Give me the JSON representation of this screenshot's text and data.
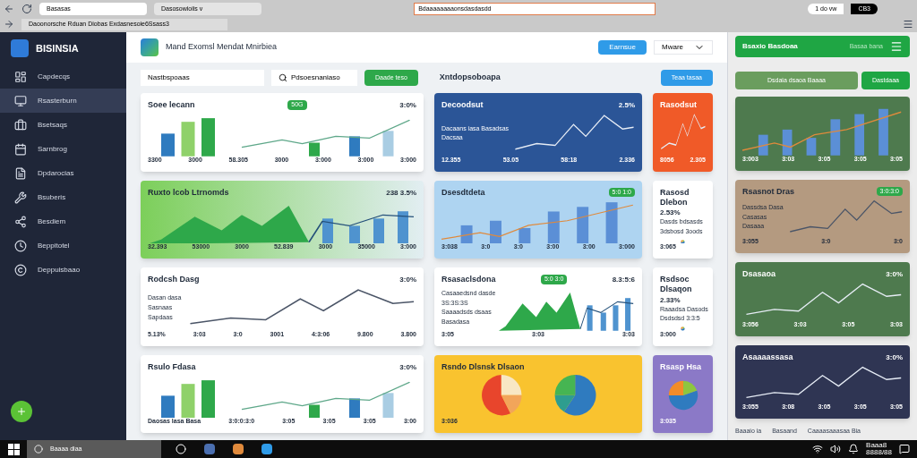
{
  "browser": {
    "tabs": [
      {
        "label": "Basasas",
        "selected": true
      },
      {
        "label": "Dasosowioiis v",
        "selected": false
      }
    ],
    "address": "Daoonorsche Rduan Diobas Exdasnesoie6Ssass3",
    "popup_address": "Bdaaaaaaaaonsdasdasdd",
    "pill": "1 do vw",
    "pill_dark": "CB3"
  },
  "sidebar": {
    "brand": "BISINSIA",
    "items": [
      {
        "label": "Capdecqs",
        "selected": false
      },
      {
        "label": "Rsasterburn",
        "selected": true
      },
      {
        "label": "Bsetsaqs",
        "selected": false
      },
      {
        "label": "Sarnbrog",
        "selected": false
      },
      {
        "label": "Dpdarocias",
        "selected": false
      },
      {
        "label": "Bsuberis",
        "selected": false
      },
      {
        "label": "Besdiem",
        "selected": false
      },
      {
        "label": "Beppitotel",
        "selected": false
      },
      {
        "label": "Deppuisbaao",
        "selected": false
      }
    ]
  },
  "header": {
    "title": "Mand Exomsl Mendat Mnirbiea",
    "button": "Earnsue",
    "select": "Mware"
  },
  "toolbar": {
    "input": "Nastbspoaas",
    "search": "Pdsoesnaniaso",
    "button": "Daade teso",
    "section_title": "Xntdopsoboapa",
    "section_button": "Teaa tasaa"
  },
  "cards": [
    {
      "color": "#ffffff",
      "kind": "bar-line",
      "title": "Soee lecann",
      "tag": "50G",
      "value": "3:0%",
      "stats": [
        "3300",
        "3000",
        "58.305",
        "3000",
        "3:000",
        "3:000",
        "3:000"
      ]
    },
    {
      "color": "#2b5597",
      "kind": "line",
      "title": "Decoodsut",
      "value": "2.5%",
      "legend": [
        "Dacaans iasa Basadsas",
        "Dacsaa"
      ],
      "stats": [
        "12.355",
        "53.05",
        "58:18",
        "2.336"
      ]
    },
    {
      "color": "#f05a28",
      "kind": "line",
      "title": "Rasodsut",
      "stats": [
        "8056",
        "2.305"
      ]
    },
    {
      "color": "#7ccf5a",
      "kind": "area",
      "title": "Ruxto lcob Ltrnomds",
      "value": "238 3.5%",
      "stats": [
        "32.393",
        "53000",
        "3000",
        "52.839",
        "3000",
        "35000",
        "3:000"
      ]
    },
    {
      "color": "#aed4f1",
      "kind": "bars",
      "title": "Dsesdtdeta",
      "tag": "5:0 1:0",
      "stats": [
        "3:038",
        "3:0",
        "3:0",
        "3:00",
        "3:00",
        "3:000"
      ]
    },
    {
      "color": "#ffffff",
      "kind": "pie",
      "title": "Rasosd Dlebon",
      "legend": [
        "Dasds bdsasds",
        "3dsbosd 3oods"
      ],
      "value": "2.53%",
      "stats": [
        "3:065"
      ]
    },
    {
      "color": "#ffffff",
      "kind": "line",
      "title": "Rodcsh Dasg",
      "value": "3:0%",
      "legend": [
        "Dasan dasa",
        "Sasnaas",
        "Sapdaas"
      ],
      "stats": [
        "5.13%",
        "3:03",
        "3:0",
        "3001",
        "4:3:06",
        "9.800",
        "3.800"
      ]
    },
    {
      "color": "#ffffff",
      "kind": "area",
      "title": "Rsasaclsdona",
      "tag": "5:0 3:0",
      "legend": [
        "Casaaedsnd dasde",
        "3S:3S:3S",
        "Saaaadsds dsaas",
        "Basadasa"
      ],
      "value": "8.3:5:6",
      "stats": [
        "3:05",
        "3:03",
        "3:03"
      ]
    },
    {
      "color": "#ffffff",
      "kind": "pie",
      "title": "Rsdsoc Dlsaqon",
      "legend": [
        "Raaadsa Dasods",
        "Dsdsdsd 3:3:5"
      ],
      "value": "2.33%",
      "stats": [
        "3:000"
      ]
    },
    {
      "color": "#ffffff",
      "kind": "bar-line",
      "title": "Rsulo Fdasa",
      "value": "3:0%",
      "stats": [
        "Daosas lasa Basa",
        "3:0:0:3:0",
        "3:05",
        "3:05",
        "3:05",
        "3:00"
      ]
    },
    {
      "color": "#f9c32f",
      "kind": "two-pies",
      "title": "Rsndo Dlsnsk Dlsaon",
      "stats": [
        "3:036"
      ]
    },
    {
      "color": "#8b79c7",
      "kind": "pie",
      "title": "Rsasp Hsa",
      "stats": [
        "3:035"
      ]
    }
  ],
  "panel": {
    "title": "Bsaxio Basdoaa",
    "subtitle": "Basaa bana",
    "button": "Dsdaia dsaoa Baaaa",
    "button2": "Dastdaaa",
    "cards": [
      {
        "color": "#4e7a4e",
        "kind": "bars",
        "stats": [
          "3:003",
          "3:03",
          "3:05",
          "3:05",
          "3:05"
        ]
      },
      {
        "color": "#b49a80",
        "kind": "line",
        "title": "Rsasnot Dras",
        "tag": "3:0:3:0",
        "legend": [
          "Dassdsa Dasa",
          "Casasas",
          "Dasaaa"
        ],
        "stats": [
          "3:055",
          "3:0",
          "3:0"
        ]
      },
      {
        "color": "#4e7a4e",
        "kind": "line",
        "title": "Dsasaoa",
        "value": "3:0%",
        "stats": [
          "3:056",
          "3:03",
          "3:05",
          "3:03"
        ]
      },
      {
        "color": "#2f3553",
        "kind": "line",
        "title": "Asaaaassasa",
        "value": "3:0%",
        "stats": [
          "3:055",
          "3:08",
          "3:05",
          "3:05",
          "3:05"
        ]
      }
    ],
    "footer": [
      "Baaaio ia",
      "Basaand",
      "Caaaasaaasaa Bia"
    ]
  },
  "taskbar": {
    "search": "Baaaa diaa",
    "time": "Baaa8",
    "date": "8888/88"
  }
}
